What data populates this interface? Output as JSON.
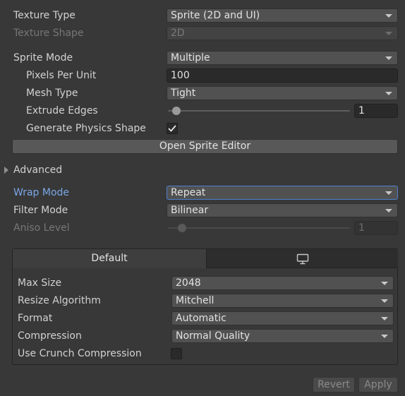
{
  "inspector": {
    "texture_type": {
      "label": "Texture Type",
      "value": "Sprite (2D and UI)"
    },
    "texture_shape": {
      "label": "Texture Shape",
      "value": "2D"
    },
    "sprite_mode": {
      "label": "Sprite Mode",
      "value": "Multiple"
    },
    "pixels_per_unit": {
      "label": "Pixels Per Unit",
      "value": "100"
    },
    "mesh_type": {
      "label": "Mesh Type",
      "value": "Tight"
    },
    "extrude_edges": {
      "label": "Extrude Edges",
      "value": "1"
    },
    "generate_physics_shape": {
      "label": "Generate Physics Shape",
      "checked": true
    },
    "open_sprite_editor": "Open Sprite Editor",
    "advanced": "Advanced",
    "wrap_mode": {
      "label": "Wrap Mode",
      "value": "Repeat"
    },
    "filter_mode": {
      "label": "Filter Mode",
      "value": "Bilinear"
    },
    "aniso_level": {
      "label": "Aniso Level",
      "value": "1"
    }
  },
  "platform": {
    "tabs": [
      {
        "label": "Default",
        "selected": true
      },
      {
        "icon": "monitor-icon",
        "selected": false
      }
    ],
    "max_size": {
      "label": "Max Size",
      "value": "2048"
    },
    "resize_algorithm": {
      "label": "Resize Algorithm",
      "value": "Mitchell"
    },
    "format": {
      "label": "Format",
      "value": "Automatic"
    },
    "compression": {
      "label": "Compression",
      "value": "Normal Quality"
    },
    "use_crunch_compression": {
      "label": "Use Crunch Compression",
      "checked": false
    }
  },
  "footer": {
    "revert": "Revert",
    "apply": "Apply"
  },
  "colors": {
    "background": "#383838",
    "accent_label": "#7ba7e6",
    "focus_border": "#4d7fcf"
  }
}
